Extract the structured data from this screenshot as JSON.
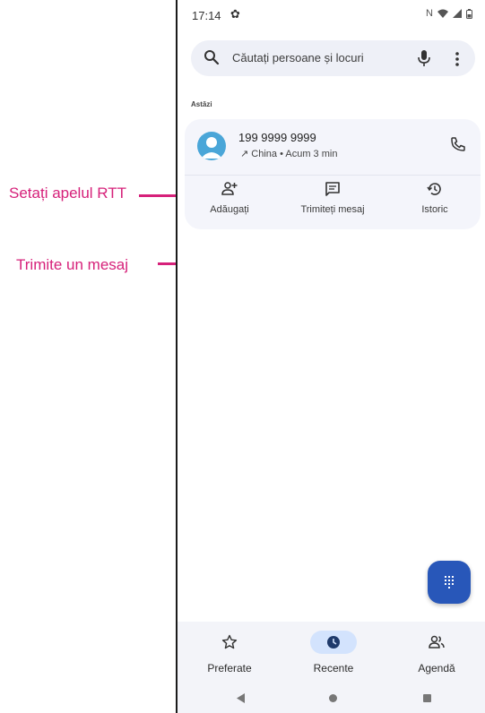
{
  "annotations": {
    "rtt": "Setați apelul RTT",
    "message": "Trimite un mesaj"
  },
  "status_bar": {
    "time": "17:14",
    "left_icons": [
      "gear-icon"
    ],
    "right_icons": [
      "nfc-icon",
      "wifi-icon",
      "signal-icon",
      "battery-icon"
    ]
  },
  "search": {
    "placeholder": "Căutați persoane și locuri"
  },
  "section": {
    "label": "Astăzi"
  },
  "call_log": [
    {
      "number": "199 9999 9999",
      "detail": "↗  China • Acum 3 min",
      "actions": [
        {
          "label": "Adăugați",
          "icon": "add-contact-icon"
        },
        {
          "label": "Trimiteți mesaj",
          "icon": "message-icon"
        },
        {
          "label": "Istoric",
          "icon": "history-icon"
        }
      ]
    }
  ],
  "bottom_nav": {
    "items": [
      {
        "label": "Preferate",
        "icon": "star-icon",
        "active": false
      },
      {
        "label": "Recente",
        "icon": "clock-icon",
        "active": true
      },
      {
        "label": "Agendă",
        "icon": "contacts-icon",
        "active": false
      }
    ]
  },
  "colors": {
    "accent": "#2857b9",
    "annotation": "#d6217a",
    "active_pill": "#d3e3fd"
  }
}
